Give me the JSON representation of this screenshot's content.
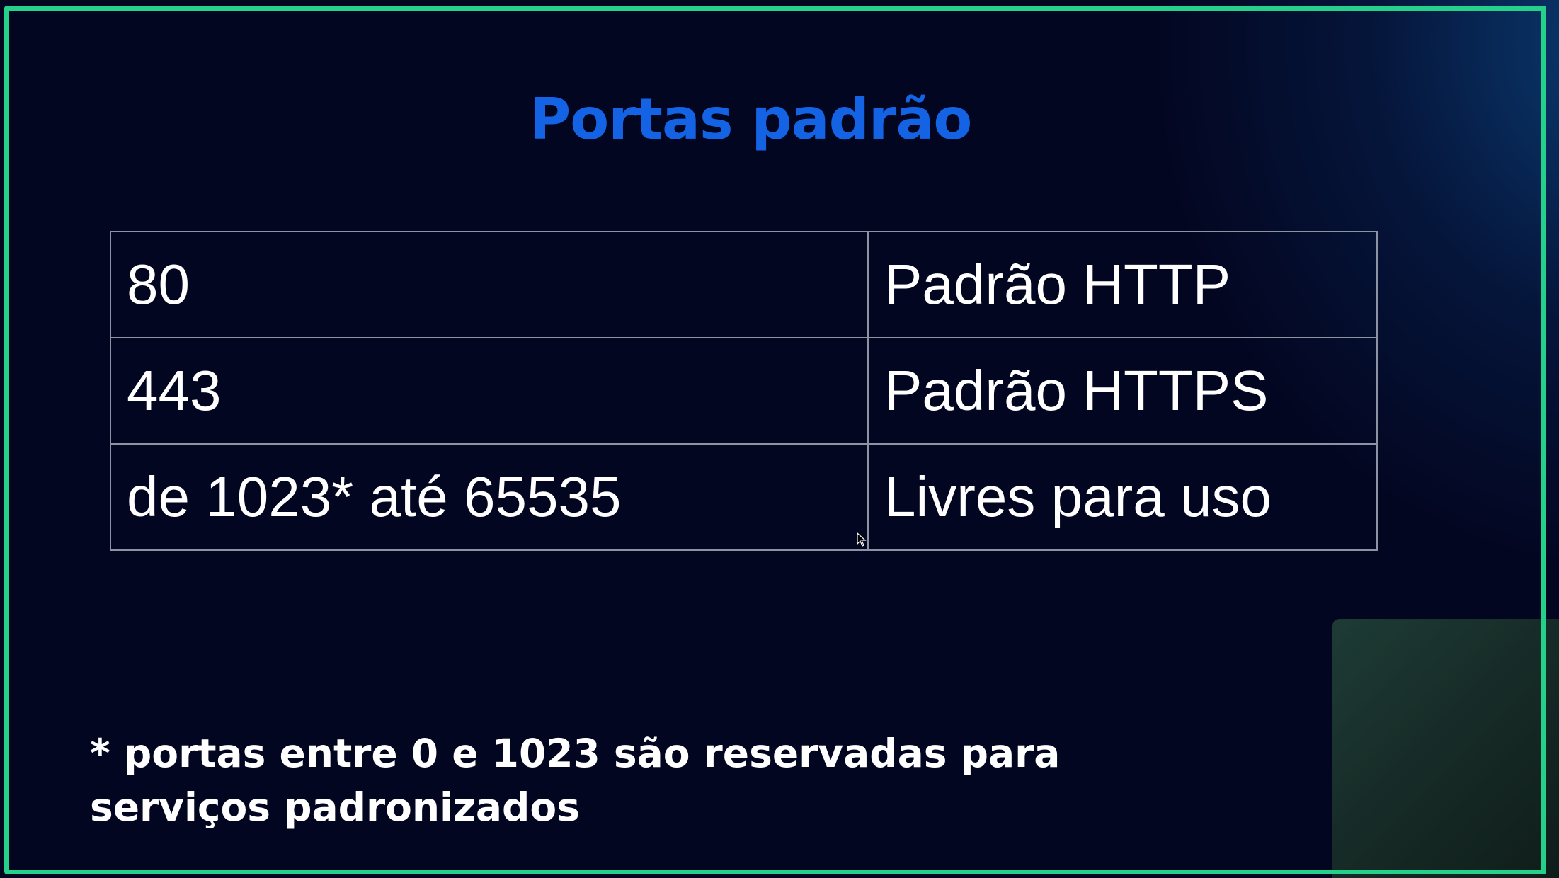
{
  "slide": {
    "title": "Portas padrão",
    "rows": [
      {
        "port": "80",
        "description": "Padrão HTTP"
      },
      {
        "port": "443",
        "description": "Padrão HTTPS"
      },
      {
        "port": "de 1023* até 65535",
        "description": "Livres para uso"
      }
    ],
    "footnote_line1": "* portas entre 0 e 1023 são reservadas para",
    "footnote_line2": "serviços padronizados"
  },
  "colors": {
    "background": "#030621",
    "frame_border": "#25d08a",
    "title": "#1463e4",
    "text": "#ffffff",
    "table_border": "#8d93a3"
  }
}
